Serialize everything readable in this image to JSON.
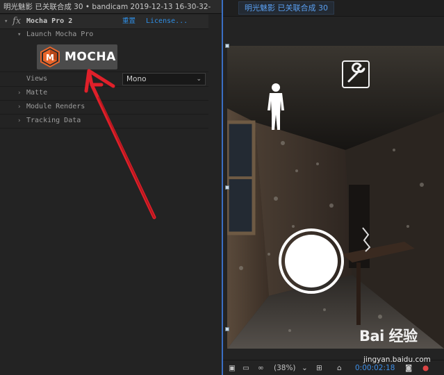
{
  "effect_controls": {
    "header": "明光魅影 已关联合成 30 • bandicam 2019-12-13 16-30-32-",
    "effect_name": "Mocha Pro 2",
    "reset_label": "重置",
    "license_label": "License...",
    "launch_group_label": "Launch Mocha Pro",
    "mocha_button_label": "MOCHA",
    "views_label": "Views",
    "views_value": "Mono",
    "matte_label": "Matte",
    "module_renders_label": "Module Renders",
    "tracking_data_label": "Tracking Data"
  },
  "composition": {
    "tab_label": "明光魅影 已关联合成 30",
    "toolbar": {
      "zoom_level": "(38%)",
      "timecode": "0:00:02:18"
    }
  },
  "watermark": {
    "brand": "Bai 经验",
    "url": "jingyan.baidu.com"
  },
  "colors": {
    "link_blue": "#2f8fe6",
    "annotation_red": "#e0202a",
    "panel_focus_blue": "#3a6fc4",
    "mocha_orange": "#e8652b"
  },
  "icons": [
    "fx-icon",
    "twirl-triangle-icon",
    "mocha-logo-icon",
    "chevron-down-icon",
    "wrench-icon",
    "person-icon",
    "camera-shutter-icon",
    "monitor-icon",
    "vr-goggles-icon",
    "snapshot-icon",
    "color-channels-icon"
  ]
}
